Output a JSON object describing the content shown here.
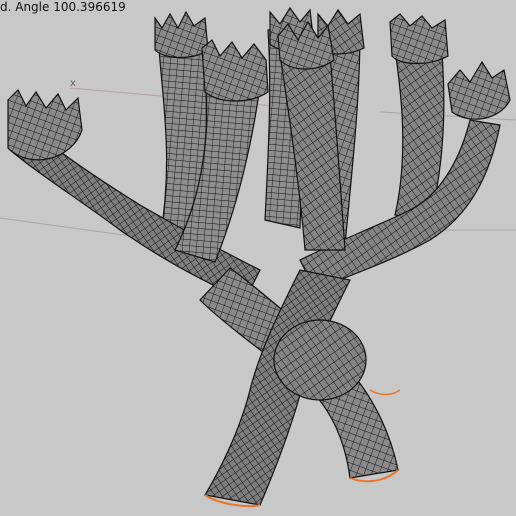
{
  "viewport": {
    "readout_text": "d. Angle 100.396619",
    "axis_label": "x",
    "colors": {
      "background": "#c8c8c8",
      "wire": "#111111",
      "mesh_fill": "#7a7a7a",
      "selection_edge": "#e8762a",
      "grid_line": "#a7a7a7",
      "axis_x": "#b07a7a"
    }
  }
}
